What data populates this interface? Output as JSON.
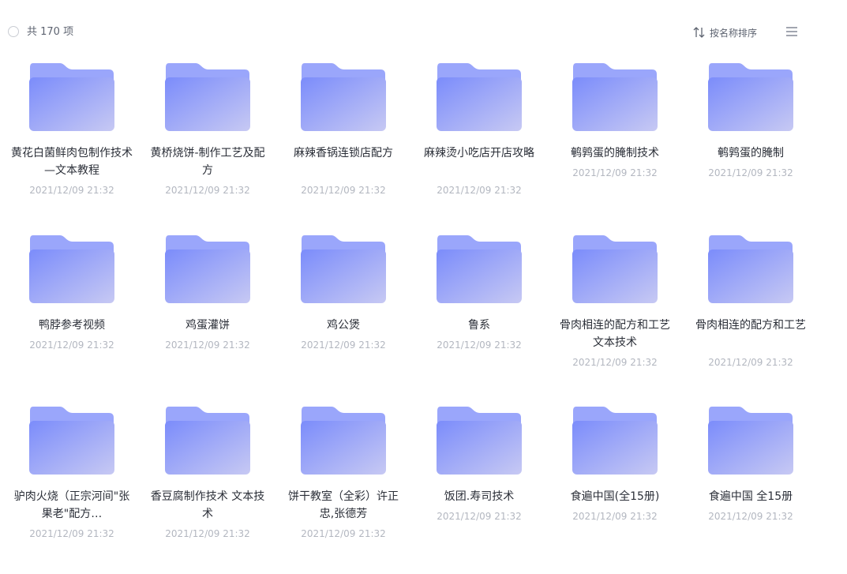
{
  "header": {
    "count_label": "共 170 项",
    "sort_label": "按名称排序"
  },
  "colors": {
    "folder_back": "#9aa6fb",
    "folder_front_start": "#7b8cfb",
    "folder_front_end": "#c7c9f3"
  },
  "folders": [
    {
      "name": "黄花白菌鲜肉包制作技术—文本教程",
      "date": "2021/12/09 21:32",
      "lines": 2
    },
    {
      "name": "黄桥烧饼-制作工艺及配方",
      "date": "2021/12/09 21:32",
      "lines": 2
    },
    {
      "name": "麻辣香锅连锁店配方",
      "date": "2021/12/09 21:32",
      "lines": 2
    },
    {
      "name": "麻辣烫小吃店开店攻略",
      "date": "2021/12/09 21:32",
      "lines": 2
    },
    {
      "name": "鹌鹑蛋的腌制技术",
      "date": "2021/12/09 21:32",
      "lines": 1
    },
    {
      "name": "鹌鹑蛋的腌制",
      "date": "2021/12/09 21:32",
      "lines": 1
    },
    {
      "name": "鸭脖参考视频",
      "date": "2021/12/09 21:32",
      "lines": 1
    },
    {
      "name": "鸡蛋灌饼",
      "date": "2021/12/09 21:32",
      "lines": 1
    },
    {
      "name": "鸡公煲",
      "date": "2021/12/09 21:32",
      "lines": 1
    },
    {
      "name": "鲁系",
      "date": "2021/12/09 21:32",
      "lines": 1
    },
    {
      "name": "骨肉相连的配方和工艺 文本技术",
      "date": "2021/12/09 21:32",
      "lines": 2
    },
    {
      "name": "骨肉相连的配方和工艺",
      "date": "2021/12/09 21:32",
      "lines": 2
    },
    {
      "name": "驴肉火烧（正宗河间\"张果老\"配方…",
      "date": "2021/12/09 21:32",
      "lines": 2
    },
    {
      "name": "香豆腐制作技术 文本技术",
      "date": "2021/12/09 21:32",
      "lines": 2
    },
    {
      "name": "饼干教室（全彩）许正忠,张德芳",
      "date": "2021/12/09 21:32",
      "lines": 2
    },
    {
      "name": "饭团.寿司技术",
      "date": "2021/12/09 21:32",
      "lines": 1
    },
    {
      "name": "食遍中国(全15册)",
      "date": "2021/12/09 21:32",
      "lines": 1
    },
    {
      "name": "食遍中国 全15册",
      "date": "2021/12/09 21:32",
      "lines": 1
    }
  ]
}
